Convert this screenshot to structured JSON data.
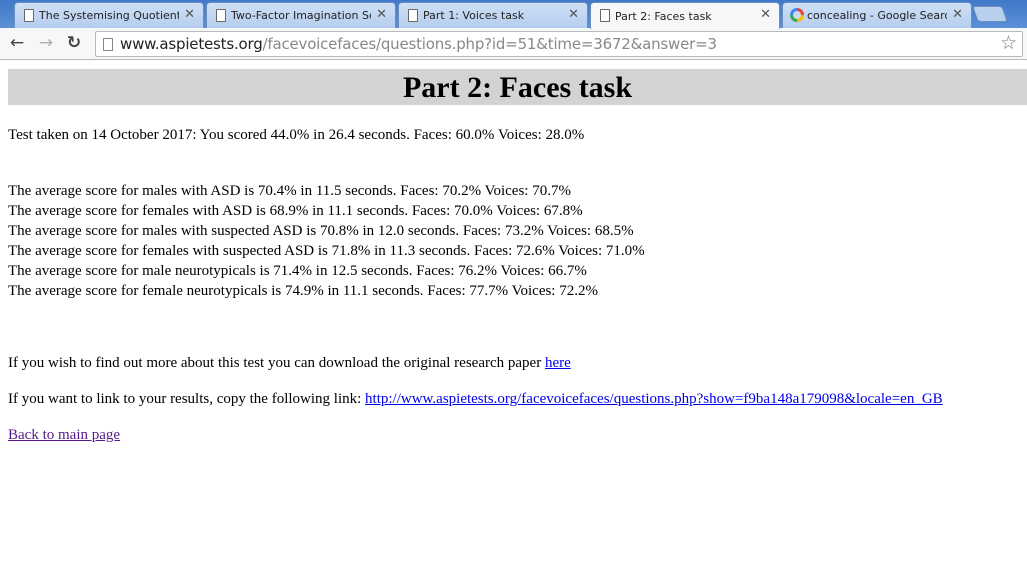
{
  "browser": {
    "tabs": [
      {
        "title": "The Systemising Quotient (S",
        "icon": "page-icon",
        "active": false
      },
      {
        "title": "Two-Factor Imagination Scal",
        "icon": "page-icon",
        "active": false
      },
      {
        "title": "Part 1: Voices task",
        "icon": "page-icon",
        "active": false
      },
      {
        "title": "Part 2: Faces task",
        "icon": "page-icon",
        "active": true
      },
      {
        "title": "concealing - Google Search",
        "icon": "google-icon",
        "active": false
      }
    ],
    "close_glyph": "✕",
    "nav": {
      "back": "←",
      "forward": "→",
      "reload": "↻"
    },
    "url_host": "www.aspietests.org",
    "url_path": "/facevoicefaces/questions.php?id=51&time=3672&answer=3",
    "star_glyph": "☆"
  },
  "page": {
    "title": "Part 2: Faces task",
    "result_line": "Test taken on 14 October 2017: You scored 44.0% in 26.4 seconds. Faces: 60.0% Voices: 28.0%",
    "averages": [
      "The average score for males with ASD is 70.4% in 11.5 seconds. Faces: 70.2% Voices: 70.7%",
      "The average score for females with ASD is 68.9% in 11.1 seconds. Faces: 70.0% Voices: 67.8%",
      "The average score for males with suspected ASD is 70.8% in 12.0 seconds. Faces: 73.2% Voices: 68.5%",
      "The average score for females with suspected ASD is 71.8% in 11.3 seconds. Faces: 72.6% Voices: 71.0%",
      "The average score for male neurotypicals is 71.4% in 12.5 seconds. Faces: 76.2% Voices: 66.7%",
      "The average score for female neurotypicals is 74.9% in 11.1 seconds. Faces: 77.7% Voices: 72.2%"
    ],
    "paper_text": "If you wish to find out more about this test you can download the original research paper ",
    "paper_link": "here",
    "share_text": "If you want to link to your results, copy the following link: ",
    "share_link": "http://www.aspietests.org/facevoicefaces/questions.php?show=f9ba148a179098&locale=en_GB",
    "back_link": "Back to main page"
  }
}
